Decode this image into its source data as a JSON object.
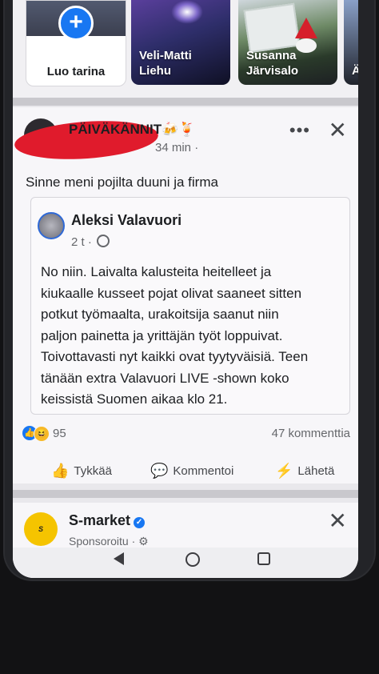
{
  "stories": [
    {
      "label": "Luo tarina"
    },
    {
      "name_line1": "Veli-Matti",
      "name_line2": "Liehu"
    },
    {
      "name_line1": "Susanna",
      "name_line2": "Järvisalo"
    },
    {
      "name_line1": "Älvs"
    }
  ],
  "post": {
    "group_name": "PÄIVÄKÄNNIT🍻🍹",
    "time": "34 min ·",
    "text": "Sinne meni pojilta duuni ja firma",
    "quoted": {
      "author": "Aleksi Valavuori",
      "time": "2 t ·",
      "lines": [
        "No niin. Laivalta kalusteita heitelleet ja",
        "kiukaalle kusseet pojat olivat saaneet sitten",
        "potkut työmaalta, urakoitsija saanut niin",
        "paljon painetta ja yrittäjän työt loppuivat.",
        "Toivottavasti nyt kaikki ovat tyytyväisiä. Teen",
        "tänään extra Valavuori LIVE -shown koko",
        "keissistä Suomen aikaa klo 21."
      ]
    },
    "reaction_count": "95",
    "comment_count": "47 kommenttia",
    "actions": {
      "like": "Tykkää",
      "comment": "Kommentoi",
      "send": "Lähetä"
    }
  },
  "sponsored": {
    "name": "S-market",
    "logo_text": "S MARKET",
    "subtitle": "Sponsoroitu ·"
  },
  "icons": {
    "more": "more-dots-icon",
    "close": "close-icon",
    "globe": "globe-icon",
    "like": "thumbs-up-icon",
    "comment": "comment-bubble-icon",
    "send": "messenger-icon"
  },
  "colors": {
    "accent": "#1877f2",
    "redaction": "#e01b2c",
    "sponsor_logo": "#f5c400"
  }
}
